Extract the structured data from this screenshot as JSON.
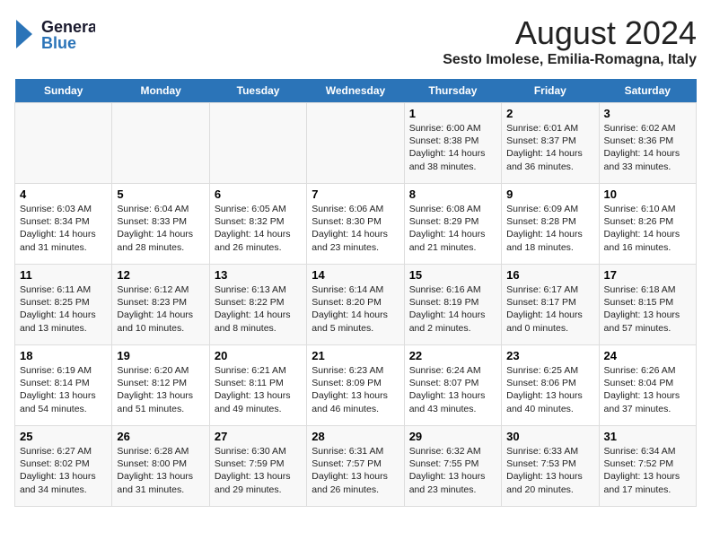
{
  "header": {
    "logo_line1": "General",
    "logo_line2": "Blue",
    "title": "August 2024",
    "subtitle": "Sesto Imolese, Emilia-Romagna, Italy"
  },
  "days": [
    "Sunday",
    "Monday",
    "Tuesday",
    "Wednesday",
    "Thursday",
    "Friday",
    "Saturday"
  ],
  "weeks": [
    {
      "cells": [
        {
          "date": "",
          "content": ""
        },
        {
          "date": "",
          "content": ""
        },
        {
          "date": "",
          "content": ""
        },
        {
          "date": "",
          "content": ""
        },
        {
          "date": "1",
          "content": "Sunrise: 6:00 AM\nSunset: 8:38 PM\nDaylight: 14 hours\nand 38 minutes."
        },
        {
          "date": "2",
          "content": "Sunrise: 6:01 AM\nSunset: 8:37 PM\nDaylight: 14 hours\nand 36 minutes."
        },
        {
          "date": "3",
          "content": "Sunrise: 6:02 AM\nSunset: 8:36 PM\nDaylight: 14 hours\nand 33 minutes."
        }
      ]
    },
    {
      "cells": [
        {
          "date": "4",
          "content": "Sunrise: 6:03 AM\nSunset: 8:34 PM\nDaylight: 14 hours\nand 31 minutes."
        },
        {
          "date": "5",
          "content": "Sunrise: 6:04 AM\nSunset: 8:33 PM\nDaylight: 14 hours\nand 28 minutes."
        },
        {
          "date": "6",
          "content": "Sunrise: 6:05 AM\nSunset: 8:32 PM\nDaylight: 14 hours\nand 26 minutes."
        },
        {
          "date": "7",
          "content": "Sunrise: 6:06 AM\nSunset: 8:30 PM\nDaylight: 14 hours\nand 23 minutes."
        },
        {
          "date": "8",
          "content": "Sunrise: 6:08 AM\nSunset: 8:29 PM\nDaylight: 14 hours\nand 21 minutes."
        },
        {
          "date": "9",
          "content": "Sunrise: 6:09 AM\nSunset: 8:28 PM\nDaylight: 14 hours\nand 18 minutes."
        },
        {
          "date": "10",
          "content": "Sunrise: 6:10 AM\nSunset: 8:26 PM\nDaylight: 14 hours\nand 16 minutes."
        }
      ]
    },
    {
      "cells": [
        {
          "date": "11",
          "content": "Sunrise: 6:11 AM\nSunset: 8:25 PM\nDaylight: 14 hours\nand 13 minutes."
        },
        {
          "date": "12",
          "content": "Sunrise: 6:12 AM\nSunset: 8:23 PM\nDaylight: 14 hours\nand 10 minutes."
        },
        {
          "date": "13",
          "content": "Sunrise: 6:13 AM\nSunset: 8:22 PM\nDaylight: 14 hours\nand 8 minutes."
        },
        {
          "date": "14",
          "content": "Sunrise: 6:14 AM\nSunset: 8:20 PM\nDaylight: 14 hours\nand 5 minutes."
        },
        {
          "date": "15",
          "content": "Sunrise: 6:16 AM\nSunset: 8:19 PM\nDaylight: 14 hours\nand 2 minutes."
        },
        {
          "date": "16",
          "content": "Sunrise: 6:17 AM\nSunset: 8:17 PM\nDaylight: 14 hours\nand 0 minutes."
        },
        {
          "date": "17",
          "content": "Sunrise: 6:18 AM\nSunset: 8:15 PM\nDaylight: 13 hours\nand 57 minutes."
        }
      ]
    },
    {
      "cells": [
        {
          "date": "18",
          "content": "Sunrise: 6:19 AM\nSunset: 8:14 PM\nDaylight: 13 hours\nand 54 minutes."
        },
        {
          "date": "19",
          "content": "Sunrise: 6:20 AM\nSunset: 8:12 PM\nDaylight: 13 hours\nand 51 minutes."
        },
        {
          "date": "20",
          "content": "Sunrise: 6:21 AM\nSunset: 8:11 PM\nDaylight: 13 hours\nand 49 minutes."
        },
        {
          "date": "21",
          "content": "Sunrise: 6:23 AM\nSunset: 8:09 PM\nDaylight: 13 hours\nand 46 minutes."
        },
        {
          "date": "22",
          "content": "Sunrise: 6:24 AM\nSunset: 8:07 PM\nDaylight: 13 hours\nand 43 minutes."
        },
        {
          "date": "23",
          "content": "Sunrise: 6:25 AM\nSunset: 8:06 PM\nDaylight: 13 hours\nand 40 minutes."
        },
        {
          "date": "24",
          "content": "Sunrise: 6:26 AM\nSunset: 8:04 PM\nDaylight: 13 hours\nand 37 minutes."
        }
      ]
    },
    {
      "cells": [
        {
          "date": "25",
          "content": "Sunrise: 6:27 AM\nSunset: 8:02 PM\nDaylight: 13 hours\nand 34 minutes."
        },
        {
          "date": "26",
          "content": "Sunrise: 6:28 AM\nSunset: 8:00 PM\nDaylight: 13 hours\nand 31 minutes."
        },
        {
          "date": "27",
          "content": "Sunrise: 6:30 AM\nSunset: 7:59 PM\nDaylight: 13 hours\nand 29 minutes."
        },
        {
          "date": "28",
          "content": "Sunrise: 6:31 AM\nSunset: 7:57 PM\nDaylight: 13 hours\nand 26 minutes."
        },
        {
          "date": "29",
          "content": "Sunrise: 6:32 AM\nSunset: 7:55 PM\nDaylight: 13 hours\nand 23 minutes."
        },
        {
          "date": "30",
          "content": "Sunrise: 6:33 AM\nSunset: 7:53 PM\nDaylight: 13 hours\nand 20 minutes."
        },
        {
          "date": "31",
          "content": "Sunrise: 6:34 AM\nSunset: 7:52 PM\nDaylight: 13 hours\nand 17 minutes."
        }
      ]
    }
  ]
}
